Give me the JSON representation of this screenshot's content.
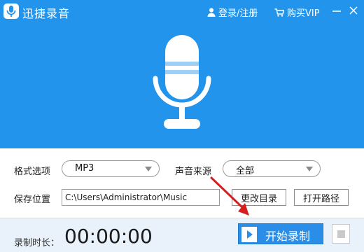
{
  "titlebar": {
    "app_title": "迅捷录音",
    "login_label": "登录/注册",
    "vip_label": "购买VIP"
  },
  "settings": {
    "format_label": "格式选项",
    "format_value": "MP3",
    "source_label": "声音来源",
    "source_value": "全部",
    "save_label": "保存位置",
    "save_path": "C:\\Users\\Administrator\\Music",
    "change_dir_label": "更改目录",
    "open_path_label": "打开路径"
  },
  "bottom": {
    "duration_label": "录制时长：",
    "timer": "00:00:00",
    "start_record_label": "开始录制"
  },
  "colors": {
    "hero_blue": "#2294ec",
    "button_blue": "#2a8ee8",
    "arrow_red": "#d61e1e"
  },
  "icons": [
    "app-mic-logo-icon",
    "user-icon",
    "cart-icon",
    "minimize-icon",
    "close-icon",
    "microphone-illustration",
    "chevron-down-icon",
    "play-icon",
    "stop-icon",
    "red-arrow-annotation"
  ]
}
